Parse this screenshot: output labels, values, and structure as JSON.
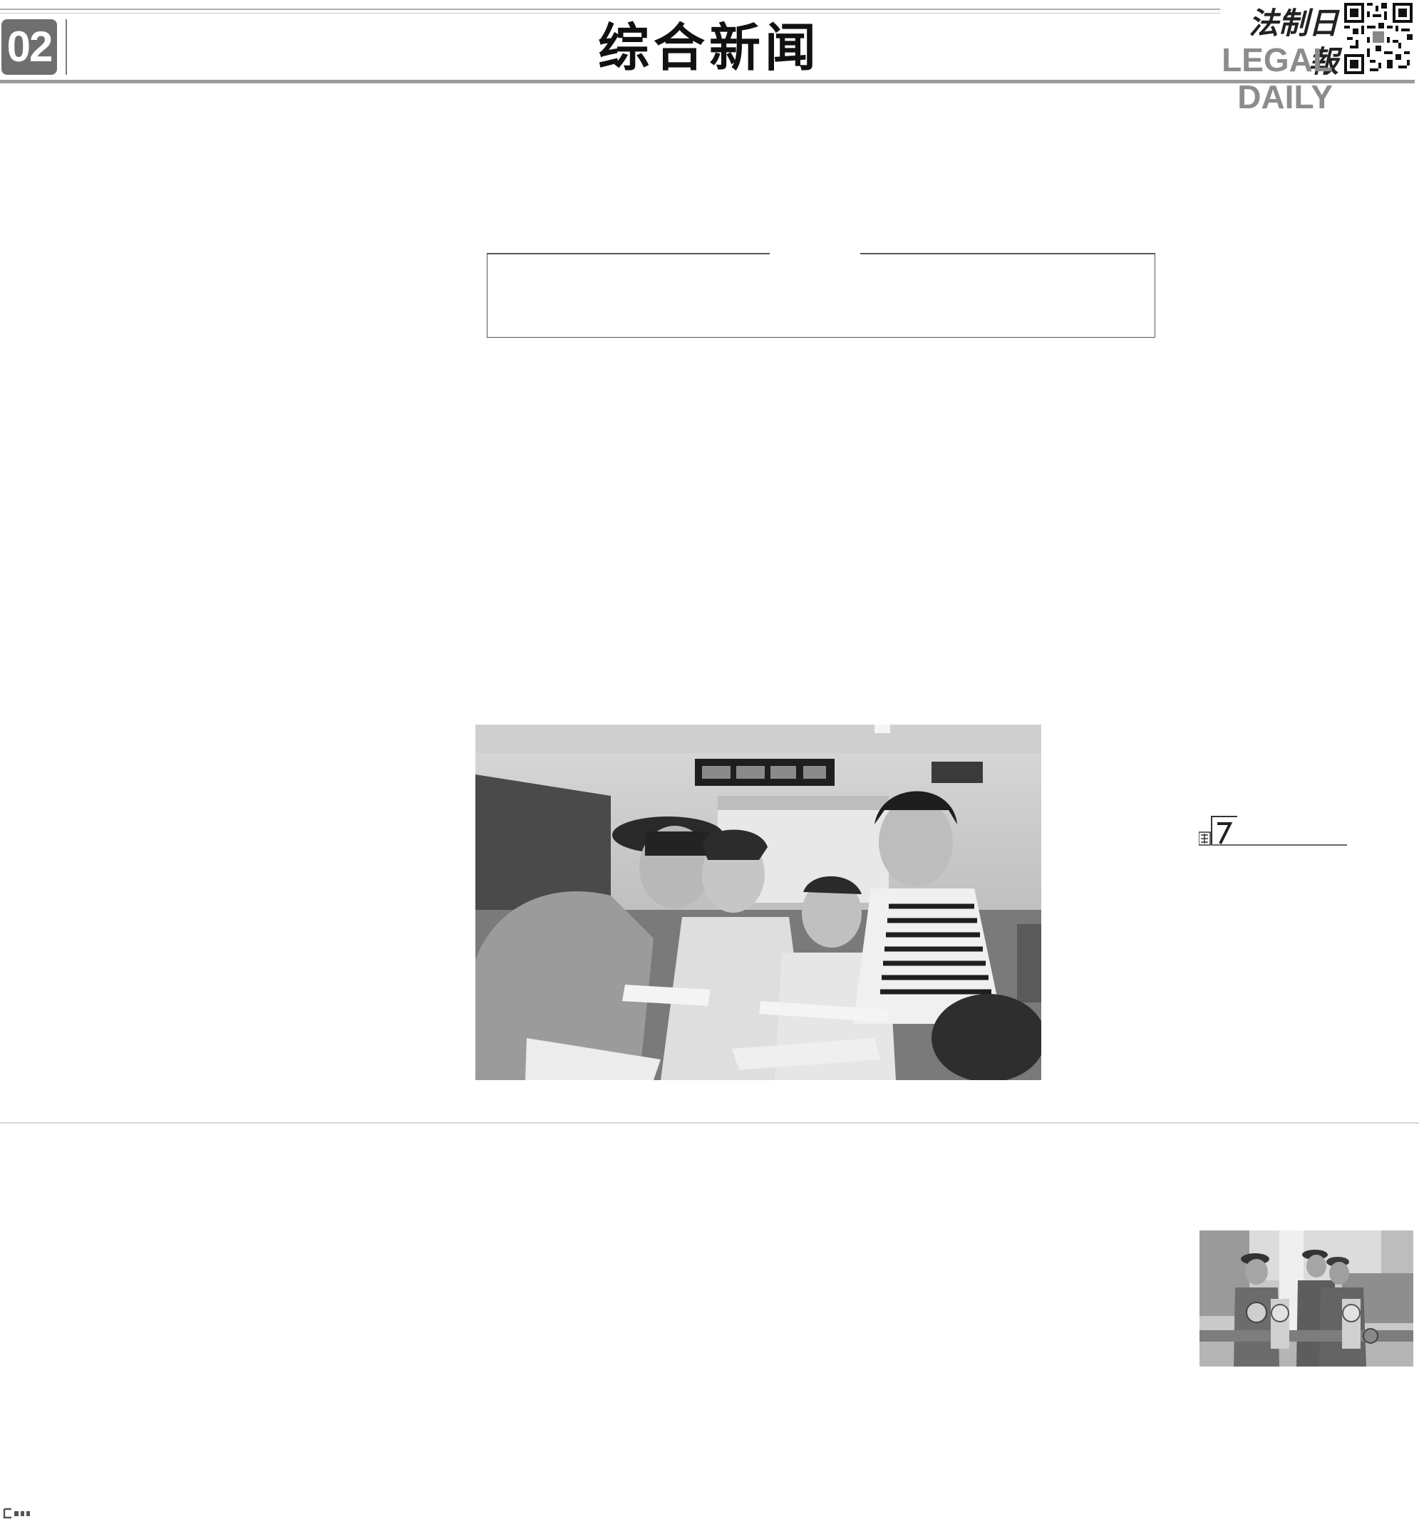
{
  "masthead": {
    "page_number": "02",
    "section_title": "综合新闻",
    "paper_name_cn": "法制日報",
    "paper_name_en": "LEGAL DAILY"
  },
  "icons": {
    "qr": "qr-code-icon",
    "marker": "column-marker-icon",
    "nav": "back-arrow-icon"
  },
  "colors": {
    "rule": "#9a9a9a",
    "page_badge": "#6f6f6f",
    "english_name": "#8c8c8c"
  }
}
